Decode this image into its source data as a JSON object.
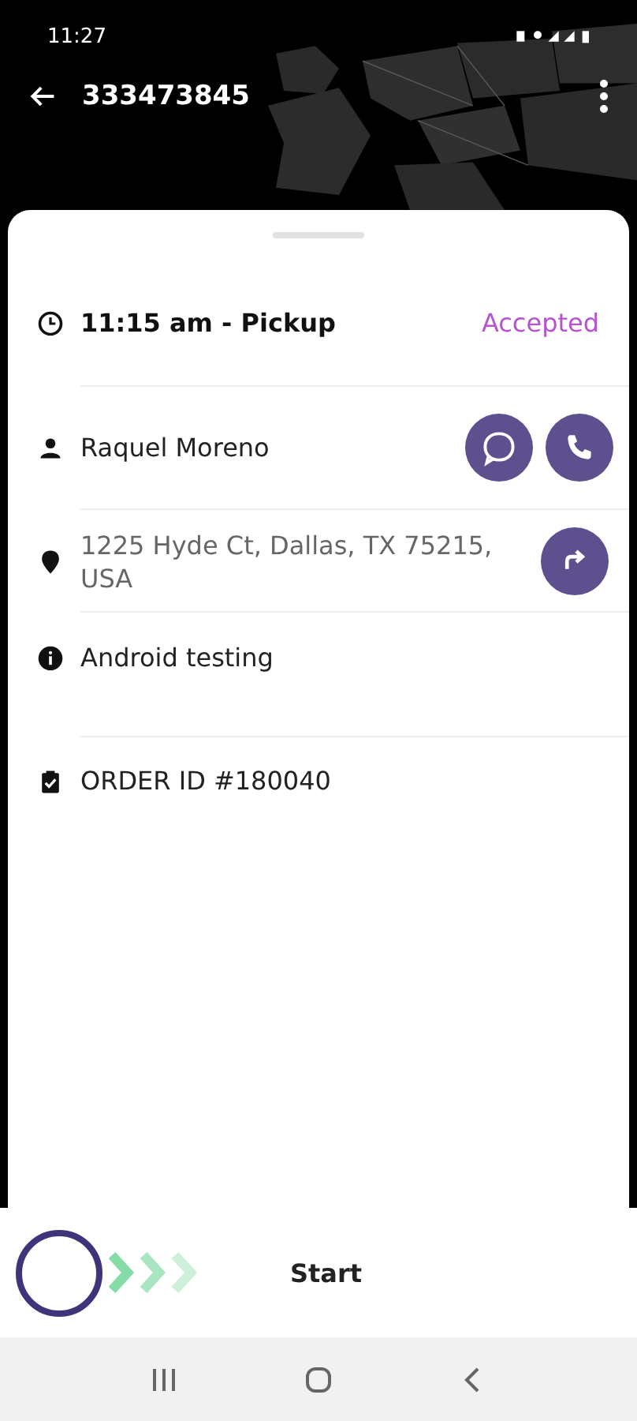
{
  "status_bar": {
    "time": "11:27"
  },
  "header": {
    "title": "333473845"
  },
  "details": [
    {
      "kind": "time",
      "text": "11:15 am - Pickup",
      "status": "Accepted"
    },
    {
      "kind": "contact",
      "text": "Raquel Moreno"
    },
    {
      "kind": "address",
      "text": "1225 Hyde Ct, Dallas, TX 75215, USA"
    },
    {
      "kind": "note",
      "text": "Android testing"
    },
    {
      "kind": "order",
      "text": "ORDER ID #180040"
    }
  ],
  "swipe_button": {
    "label": "Start"
  }
}
